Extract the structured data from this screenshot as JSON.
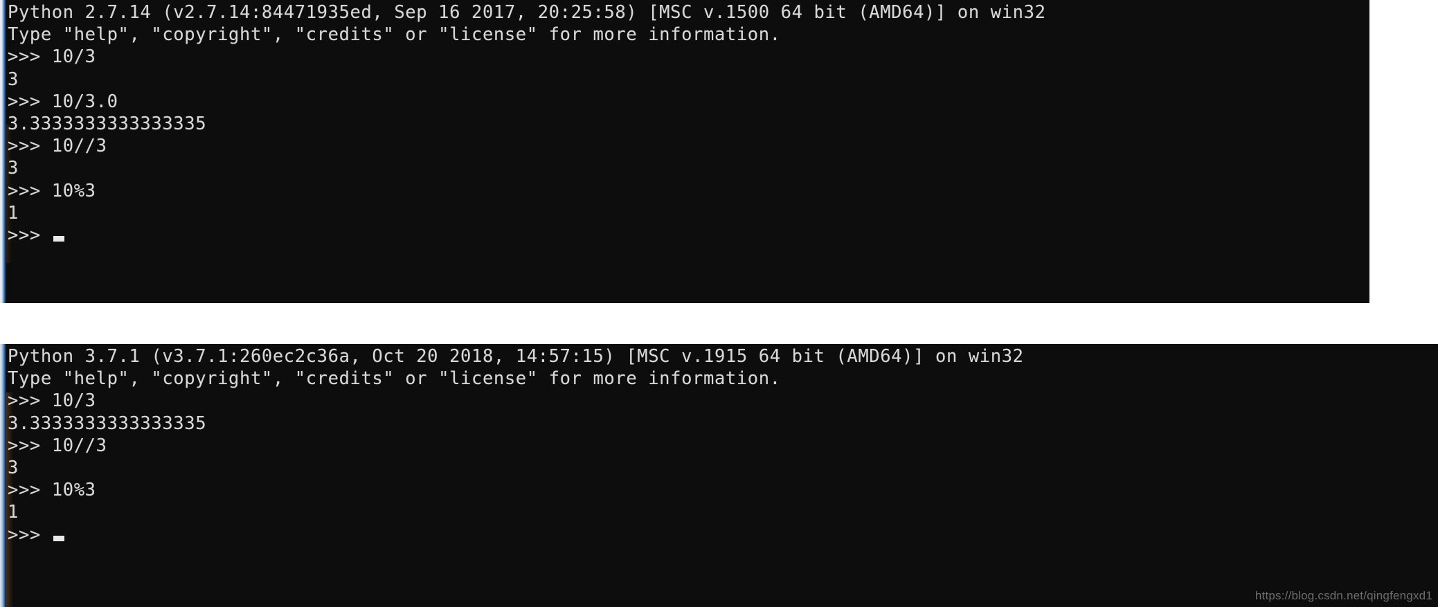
{
  "watermark": "https://blog.csdn.net/qingfengxd1",
  "consoles": [
    {
      "id": "python2",
      "title": "Python 2.7.14 console",
      "lines": [
        "Python 2.7.14 (v2.7.14:84471935ed, Sep 16 2017, 20:25:58) [MSC v.1500 64 bit (AMD64)] on win32",
        "Type \"help\", \"copyright\", \"credits\" or \"license\" for more information.",
        ">>> 10/3",
        "3",
        ">>> 10/3.0",
        "3.3333333333333335",
        ">>> 10//3",
        "3",
        ">>> 10%3",
        "1",
        ">>> "
      ],
      "banner": {
        "version": "Python 2.7.14",
        "build": "(v2.7.14:84471935ed, Sep 16 2017, 20:25:58)",
        "compiler": "[MSC v.1500 64 bit (AMD64)]",
        "platform": "on win32",
        "help_line": "Type \"help\", \"copyright\", \"credits\" or \"license\" for more information."
      },
      "entries": [
        {
          "prompt": ">>> ",
          "input": "10/3",
          "output": "3"
        },
        {
          "prompt": ">>> ",
          "input": "10/3.0",
          "output": "3.3333333333333335"
        },
        {
          "prompt": ">>> ",
          "input": "10//3",
          "output": "3"
        },
        {
          "prompt": ">>> ",
          "input": "10%3",
          "output": "1"
        }
      ],
      "final_prompt": ">>> "
    },
    {
      "id": "python3",
      "title": "Python 3.7.1 console",
      "lines": [
        "Python 3.7.1 (v3.7.1:260ec2c36a, Oct 20 2018, 14:57:15) [MSC v.1915 64 bit (AMD64)] on win32",
        "Type \"help\", \"copyright\", \"credits\" or \"license\" for more information.",
        ">>> 10/3",
        "3.3333333333333335",
        ">>> 10//3",
        "3",
        ">>> 10%3",
        "1",
        ">>> "
      ],
      "banner": {
        "version": "Python 3.7.1",
        "build": "(v3.7.1:260ec2c36a, Oct 20 2018, 14:57:15)",
        "compiler": "[MSC v.1915 64 bit (AMD64)]",
        "platform": "on win32",
        "help_line": "Type \"help\", \"copyright\", \"credits\" or \"license\" for more information."
      },
      "entries": [
        {
          "prompt": ">>> ",
          "input": "10/3",
          "output": "3.3333333333333335"
        },
        {
          "prompt": ">>> ",
          "input": "10//3",
          "output": "3"
        },
        {
          "prompt": ">>> ",
          "input": "10%3",
          "output": "1"
        }
      ],
      "final_prompt": ">>> "
    }
  ],
  "colors": {
    "console_background": "#0d0d0d",
    "console_text": "#d8d8d8",
    "page_background": "#ffffff",
    "scrollbar_accent": "#1f4f8e",
    "watermark_text": "#6e6e6e"
  }
}
